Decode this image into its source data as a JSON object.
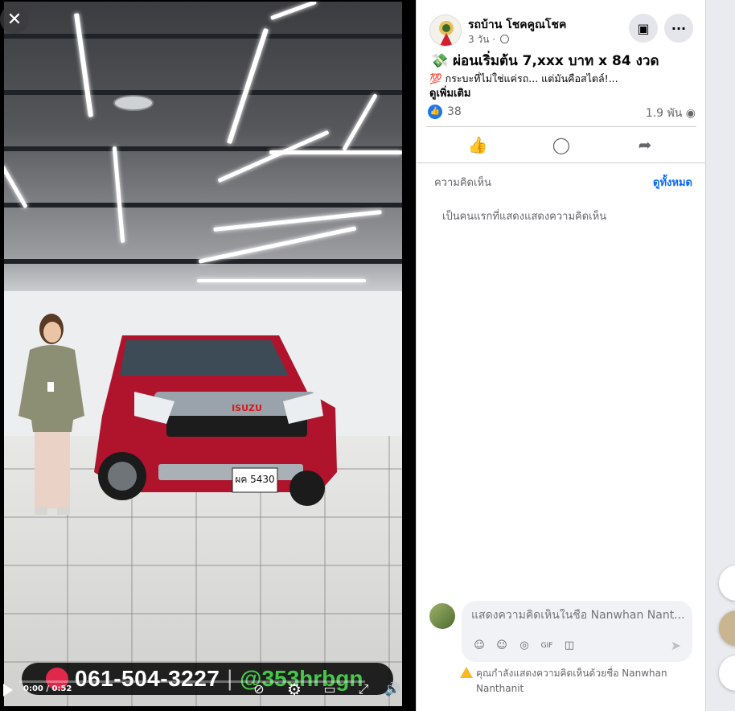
{
  "video": {
    "phone_number": "061-504-3227",
    "separator": "|",
    "line_id": "@353hrbgn",
    "time": "0:00 / 0:52",
    "progress_fraction": 0.0,
    "close_icon": "close-icon",
    "plate_text": "ผค 5430",
    "brand_text": "ISUZU"
  },
  "post": {
    "page_name": "รถบ้าน โชคคูณโชค",
    "time": "3 วัน ·",
    "headline_emoji": "💸",
    "headline": "ผ่อนเริ่มต้น 7,xxx บาท x 84 งวด",
    "sub_emoji": "💯",
    "subline": "กระบะที่ไม่ใช่แค่รถ... แต่มันคือสไตล์!...",
    "see_more": "ดูเพิ่มเติม",
    "like_count": "38",
    "views": "1.9 พัน",
    "more_icon": "···"
  },
  "comments": {
    "label": "ความคิดเห็น",
    "all_link": "ดูทั้งหมด",
    "empty_text": "เป็นคนแรกที่แสดงแสดงความคิดเห็น",
    "input_placeholder": "แสดงความคิดเห็นในชื่อ Nanwhan Nant...",
    "warning": "คุณกำลังแสดงความคิดเห็นด้วยชื่อ Nanwhan Nanthanit"
  },
  "colors": {
    "accent": "#1877f2",
    "link": "#0866ff",
    "line_green": "#46c74a",
    "phone_red": "#e0284a",
    "truck_red": "#b0142c"
  }
}
